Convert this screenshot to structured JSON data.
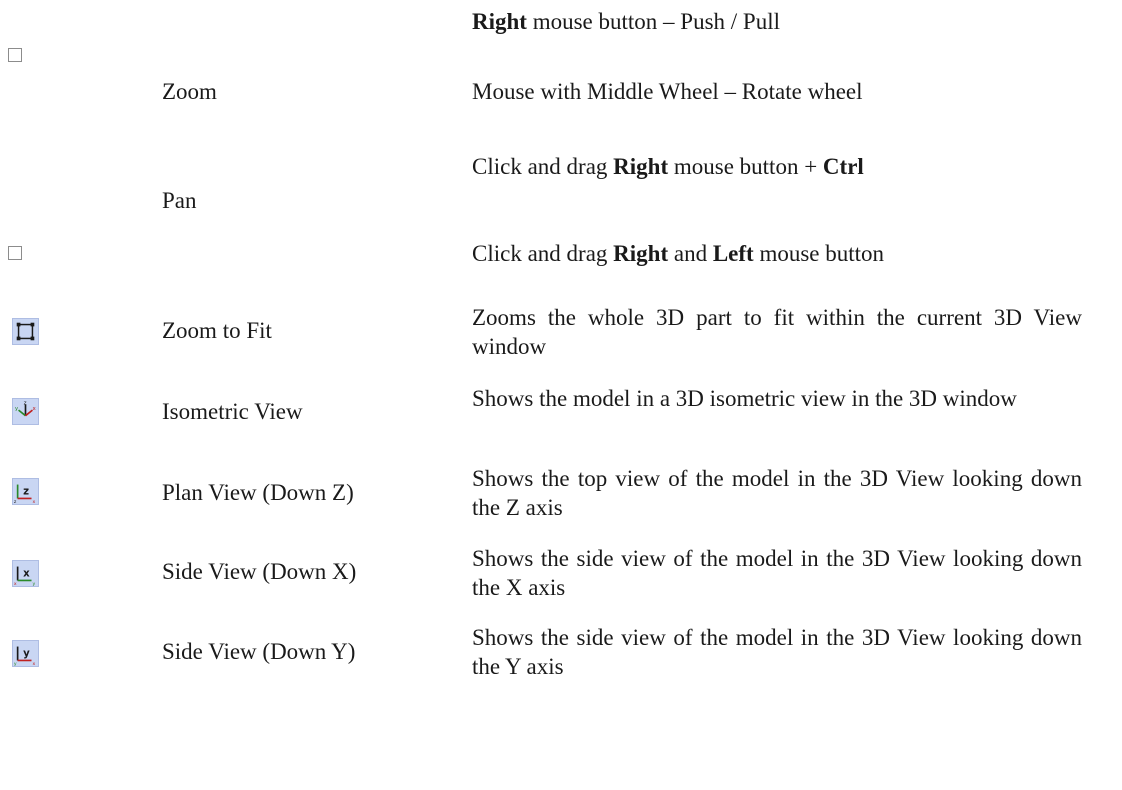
{
  "rows": {
    "rotate": {
      "desc_parts": [
        "Right",
        " mouse button – Push / Pull"
      ]
    },
    "zoom": {
      "name": "Zoom",
      "desc": "Mouse with Middle Wheel –  Rotate wheel"
    },
    "pan": {
      "name": "Pan",
      "desc1_parts": [
        "Click and drag ",
        "Right",
        " mouse button + ",
        "Ctrl"
      ],
      "desc2_parts": [
        "Click and drag ",
        "Right",
        " and ",
        "Left",
        " mouse button"
      ]
    },
    "zoom_to_fit": {
      "icon": "zoom-to-fit-icon",
      "name": "Zoom to Fit",
      "desc": "Zooms the whole 3D part to fit within the current 3D View window"
    },
    "isometric": {
      "icon": "isometric-view-icon",
      "name": "Isometric View",
      "desc": "Shows the model in a 3D isometric view in the 3D window"
    },
    "plan": {
      "icon": "plan-view-z-icon",
      "name": "Plan View (Down Z)",
      "desc": "Shows the top view of the model in the 3D View looking down the Z axis"
    },
    "side_x": {
      "icon": "side-view-x-icon",
      "name": "Side View (Down X)",
      "desc": "Shows the side view of the model in the 3D View looking down the X axis"
    },
    "side_y": {
      "icon": "side-view-y-icon",
      "name": "Side View (Down Y)",
      "desc": "Shows the side view of the model in the 3D View looking down the Y axis"
    }
  }
}
